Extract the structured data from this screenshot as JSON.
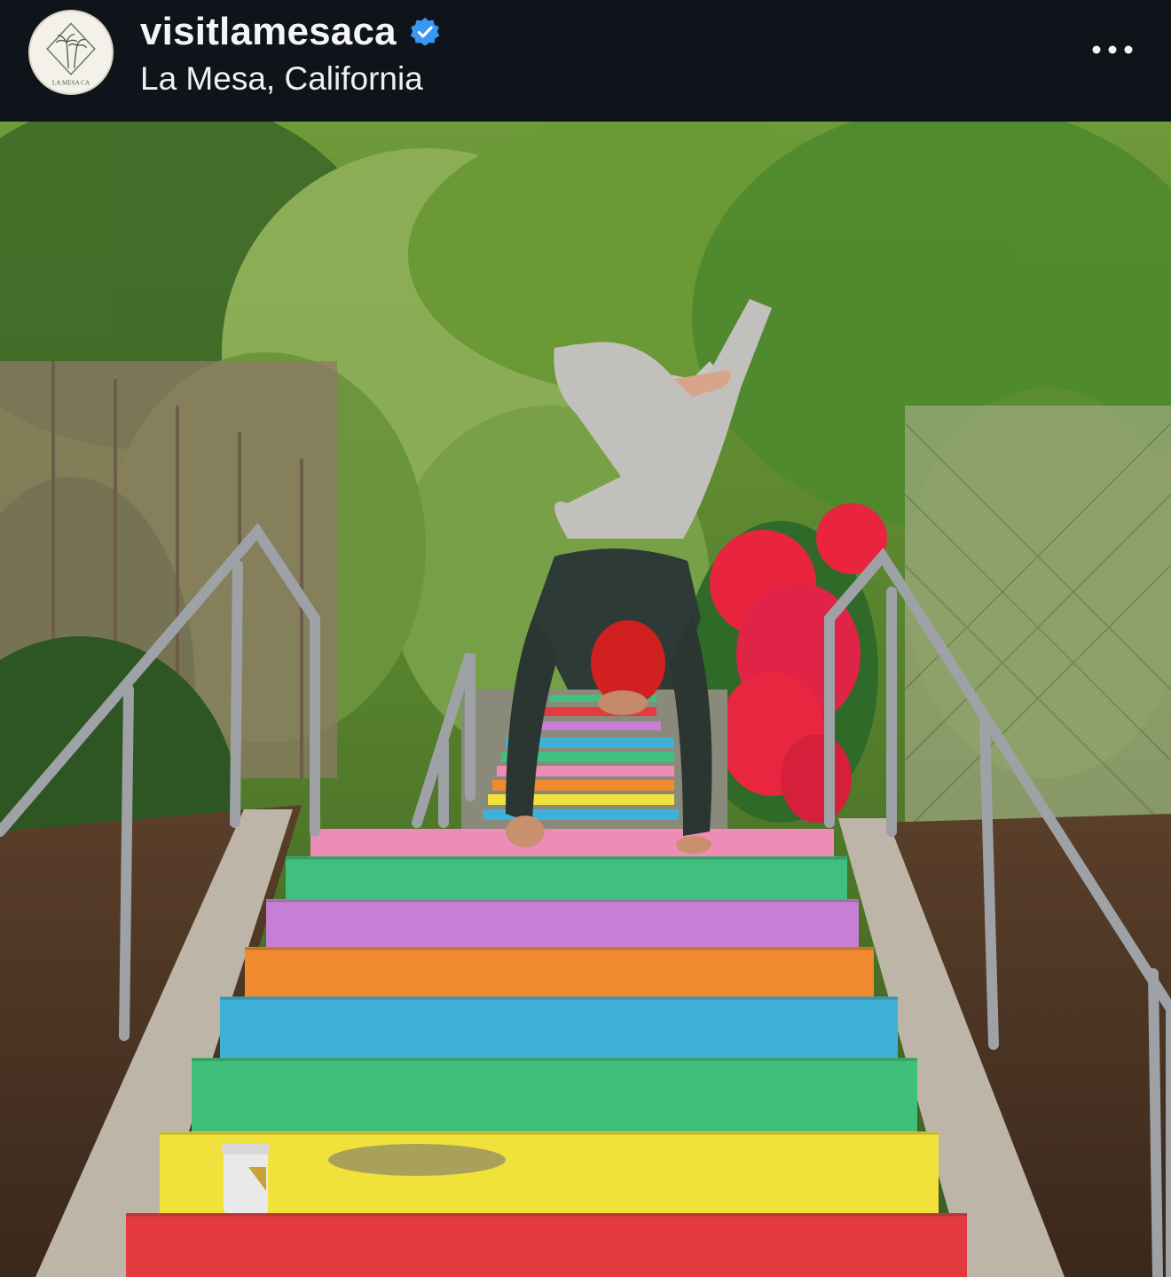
{
  "post": {
    "account": {
      "username": "visitlamesaca",
      "verified": true,
      "avatar_text": "LA MESA CA",
      "location": "La Mesa, California"
    },
    "icons": {
      "verified": "verified-badge-icon",
      "more": "more-options-icon"
    },
    "colors": {
      "header_bg": "#0f131a",
      "verified_blue": "#3897f0"
    },
    "photo": {
      "subject": "Person doing a handstand on rainbow-painted outdoor stairs",
      "step_colors": [
        "#e23a3f",
        "#f0e23a",
        "#3fbf7a",
        "#3fb1d8",
        "#f08a2e",
        "#c77fd6",
        "#3fc07e",
        "#ee8cb8"
      ]
    }
  }
}
